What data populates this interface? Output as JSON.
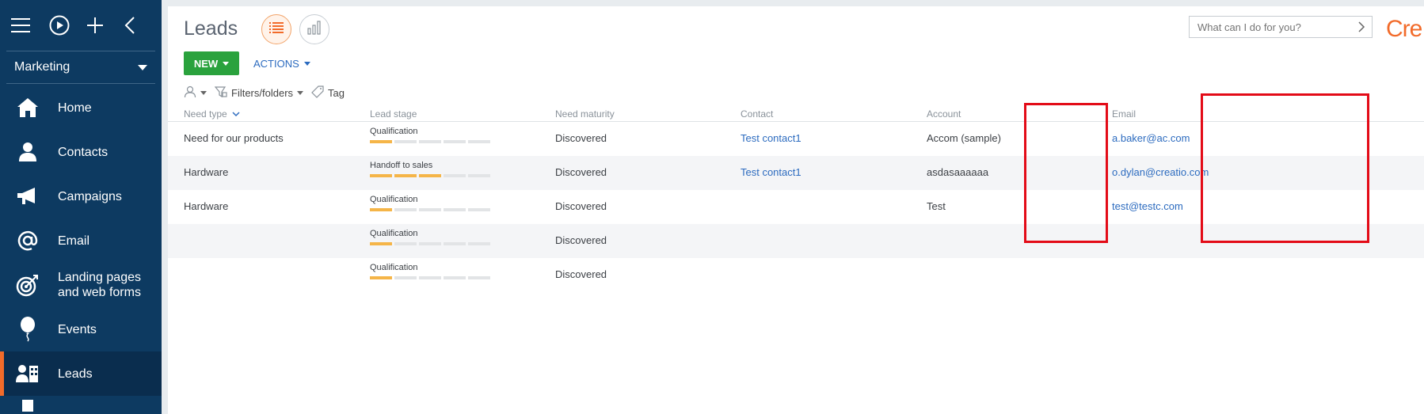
{
  "sidebar": {
    "section": "Marketing",
    "items": [
      {
        "label": "Home",
        "icon": "home-icon",
        "active": false
      },
      {
        "label": "Contacts",
        "icon": "person-icon",
        "active": false
      },
      {
        "label": "Campaigns",
        "icon": "megaphone-icon",
        "active": false
      },
      {
        "label": "Email",
        "icon": "at-icon",
        "active": false
      },
      {
        "label": "Landing pages and web forms",
        "icon": "target-icon",
        "active": false
      },
      {
        "label": "Events",
        "icon": "balloon-icon",
        "active": false
      },
      {
        "label": "Leads",
        "icon": "leads-icon",
        "active": true
      }
    ]
  },
  "header": {
    "title": "Leads",
    "search_placeholder": "What can I do for you?",
    "logo_text": "Cre"
  },
  "toolbar": {
    "new_label": "NEW",
    "actions_label": "ACTIONS"
  },
  "filters": {
    "folders_label": "Filters/folders",
    "tag_label": "Tag"
  },
  "grid": {
    "columns": [
      "Need type",
      "Lead stage",
      "Need maturity",
      "Contact",
      "Account",
      "Email"
    ],
    "rows": [
      {
        "need_type": "Need for our products",
        "stage": "Qualification",
        "stage_progress": 1,
        "maturity": "Discovered",
        "contact": "Test contact1",
        "account": "Accom (sample)",
        "email": "a.baker@ac.com"
      },
      {
        "need_type": "Hardware",
        "stage": "Handoff to sales",
        "stage_progress": 3,
        "maturity": "Discovered",
        "contact": "Test contact1",
        "account": "asdasaaaaaa",
        "email": "o.dylan@creatio.com"
      },
      {
        "need_type": "Hardware",
        "stage": "Qualification",
        "stage_progress": 1,
        "maturity": "Discovered",
        "contact": "",
        "account": "Test",
        "email": "test@testc.com"
      },
      {
        "need_type": "",
        "stage": "Qualification",
        "stage_progress": 1,
        "maturity": "Discovered",
        "contact": "",
        "account": "",
        "email": ""
      },
      {
        "need_type": "",
        "stage": "Qualification",
        "stage_progress": 1,
        "maturity": "Discovered",
        "contact": "",
        "account": "",
        "email": ""
      }
    ],
    "stage_total": 5
  },
  "colors": {
    "sidebar_bg": "#0d3a61",
    "accent": "#f26b2a",
    "new_button": "#2aa23d",
    "link": "#2c6bbf",
    "stage_on": "#f5b548",
    "highlight": "#e30b17"
  }
}
